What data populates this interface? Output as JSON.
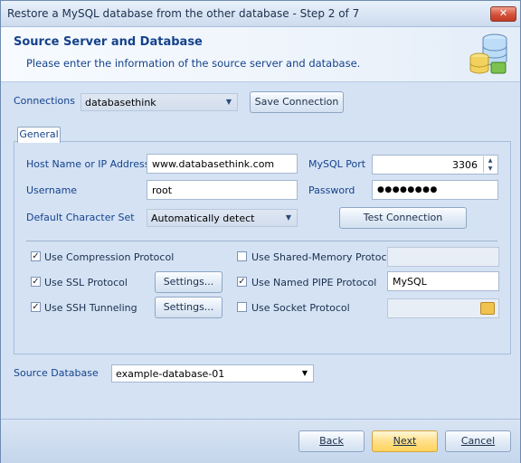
{
  "window": {
    "title": "Restore a MySQL database from the other database - Step 2 of 7",
    "close_label": "✕"
  },
  "header": {
    "title": "Source Server and Database",
    "subtitle": "Please enter the information of the source server and database.",
    "icon": "database-icon"
  },
  "connections": {
    "label": "Connections",
    "value": "databasethink",
    "save_button": "Save Connection"
  },
  "tab": {
    "label": "General"
  },
  "form": {
    "host_label": "Host Name or IP Address",
    "host_value": "www.databasethink.com",
    "port_label": "MySQL Port",
    "port_value": "3306",
    "username_label": "Username",
    "username_value": "root",
    "password_label": "Password",
    "password_value": "●●●●●●●●",
    "charset_label": "Default Character Set",
    "charset_value": "Automatically detect",
    "test_button": "Test Connection"
  },
  "options": {
    "compression": {
      "label": "Use Compression Protocol",
      "checked": true
    },
    "ssl": {
      "label": "Use SSL Protocol",
      "checked": true,
      "settings": "Settings..."
    },
    "ssh": {
      "label": "Use SSH Tunneling",
      "checked": true,
      "settings": "Settings..."
    },
    "shared_memory": {
      "label": "Use Shared-Memory Protocol",
      "checked": false,
      "value": ""
    },
    "named_pipe": {
      "label": "Use Named PIPE Protocol",
      "checked": true,
      "value": "MySQL"
    },
    "socket": {
      "label": "Use Socket Protocol",
      "checked": false,
      "value": "",
      "icon": "folder-open-icon"
    }
  },
  "source_db": {
    "label": "Source Database",
    "value": "example-database-01"
  },
  "footer": {
    "back": "Back",
    "next": "Next",
    "cancel": "Cancel"
  }
}
